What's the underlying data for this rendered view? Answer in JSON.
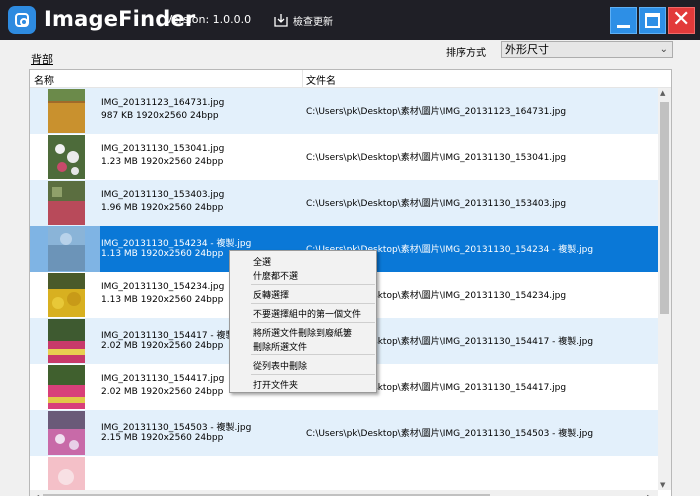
{
  "app": {
    "title": "ImageFinder",
    "version": "Version: 1.0.0.0",
    "update_label": "檢查更新"
  },
  "window": {
    "minimize_icon": "minimize-icon",
    "maximize_icon": "maximize-icon",
    "close_icon": "close-icon"
  },
  "toolbar": {
    "back_label": "背部",
    "sort_label": "排序方式",
    "sort_value": "外形尺寸"
  },
  "table": {
    "columns": [
      "名称",
      "文件名"
    ],
    "rows": [
      {
        "name": "IMG_20131123_164731.jpg",
        "meta": "987 KB  1920x2560  24bpp",
        "path": "C:\\Users\\pk\\Desktop\\素材\\圖片\\IMG_20131123_164731.jpg"
      },
      {
        "name": "IMG_20131130_153041.jpg",
        "meta": "1.23 MB  1920x2560  24bpp",
        "path": "C:\\Users\\pk\\Desktop\\素材\\圖片\\IMG_20131130_153041.jpg"
      },
      {
        "name": "IMG_20131130_153403.jpg",
        "meta": "1.96 MB  1920x2560  24bpp",
        "path": "C:\\Users\\pk\\Desktop\\素材\\圖片\\IMG_20131130_153403.jpg"
      },
      {
        "name": "IMG_20131130_154234 - 複製.jpg",
        "meta": "1.13 MB  1920x2560  24bpp",
        "path": "C:\\Users\\pk\\Desktop\\素材\\圖片\\IMG_20131130_154234 - 複製.jpg"
      },
      {
        "name": "IMG_20131130_154234.jpg",
        "meta": "1.13 MB  1920x2560  24bpp",
        "path": "C:\\Users\\pk\\Desktop\\素材\\圖片\\IMG_20131130_154234.jpg"
      },
      {
        "name": "IMG_20131130_154417 - 複製.jpg",
        "meta": "2.02 MB  1920x2560  24bpp",
        "path": "C:\\Users\\pk\\Desktop\\素材\\圖片\\IMG_20131130_154417 - 複製.jpg"
      },
      {
        "name": "IMG_20131130_154417.jpg",
        "meta": "2.02 MB  1920x2560  24bpp",
        "path": "C:\\Users\\pk\\Desktop\\素材\\圖片\\IMG_20131130_154417.jpg"
      },
      {
        "name": "IMG_20131130_154503 - 複製.jpg",
        "meta": "2.15 MB  1920x2560  24bpp",
        "path": "C:\\Users\\pk\\Desktop\\素材\\圖片\\IMG_20131130_154503 - 複製.jpg"
      },
      {
        "name": "",
        "meta": "",
        "path": ""
      }
    ],
    "selected_row": 3
  },
  "context_menu": {
    "items": [
      "全選",
      "什麼都不選",
      "反轉選擇",
      "不要選擇組中的第一個文件",
      "將所選文件刪除到廢紙簍",
      "刪除所選文件",
      "從列表中刪除",
      "打开文件夹"
    ]
  },
  "colors": {
    "titlebar": "#1f1f26",
    "selection": "#0a78d7",
    "alt_row": "#e3f0fb",
    "window_button": "#2d8fe6",
    "close_button": "#e23a3a"
  }
}
